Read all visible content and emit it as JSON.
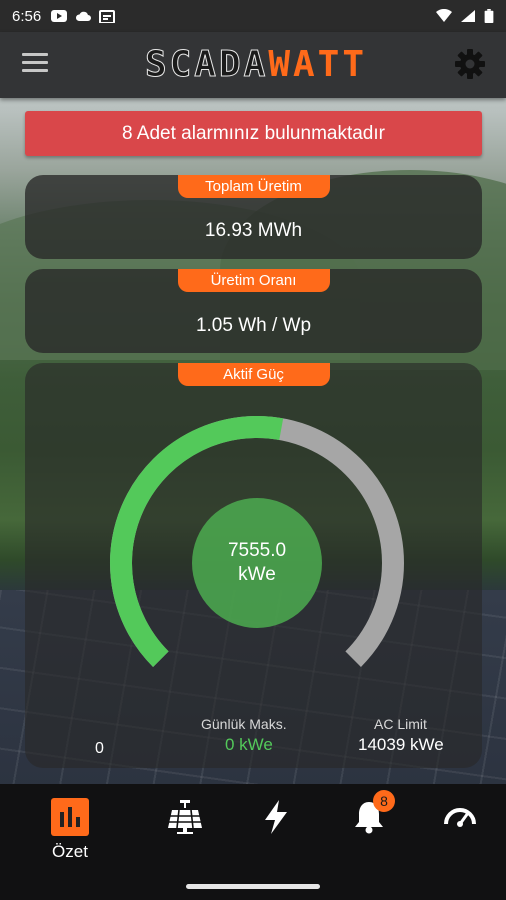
{
  "status_bar": {
    "time": "6:56"
  },
  "app_bar": {
    "logo_scada": "SCADA",
    "logo_watt": "WATT"
  },
  "alarm_banner": {
    "text": "8 Adet alarmınız bulunmaktadır"
  },
  "cards": {
    "total_production": {
      "label": "Toplam Üretim",
      "value": "16.93 MWh"
    },
    "production_rate": {
      "label": "Üretim Oranı",
      "value": "1.05 Wh / Wp"
    },
    "active_power": {
      "label": "Aktif Güç",
      "value_number": "7555.0",
      "value_unit": "kWe",
      "gauge_min": "0",
      "gauge_fill_fraction": 0.538,
      "daily_max_label": "Günlük Maks.",
      "daily_max_value": "0 kWe",
      "ac_limit_label": "AC Limit",
      "ac_limit_value": "14039 kWe"
    }
  },
  "bottom_nav": {
    "items": [
      {
        "name": "ozet",
        "label": "Özet",
        "icon": "bar-chart-icon",
        "active": true
      },
      {
        "name": "solar",
        "icon": "solar-panel-icon"
      },
      {
        "name": "power",
        "icon": "lightning-icon"
      },
      {
        "name": "alarms",
        "icon": "bell-icon",
        "badge": "8"
      },
      {
        "name": "performance",
        "icon": "gauge-icon"
      }
    ]
  },
  "colors": {
    "accent": "#ff6a1a",
    "alarm": "#d9474a",
    "gauge_fill": "#53c95a",
    "gauge_track": "#a6a6a6"
  }
}
